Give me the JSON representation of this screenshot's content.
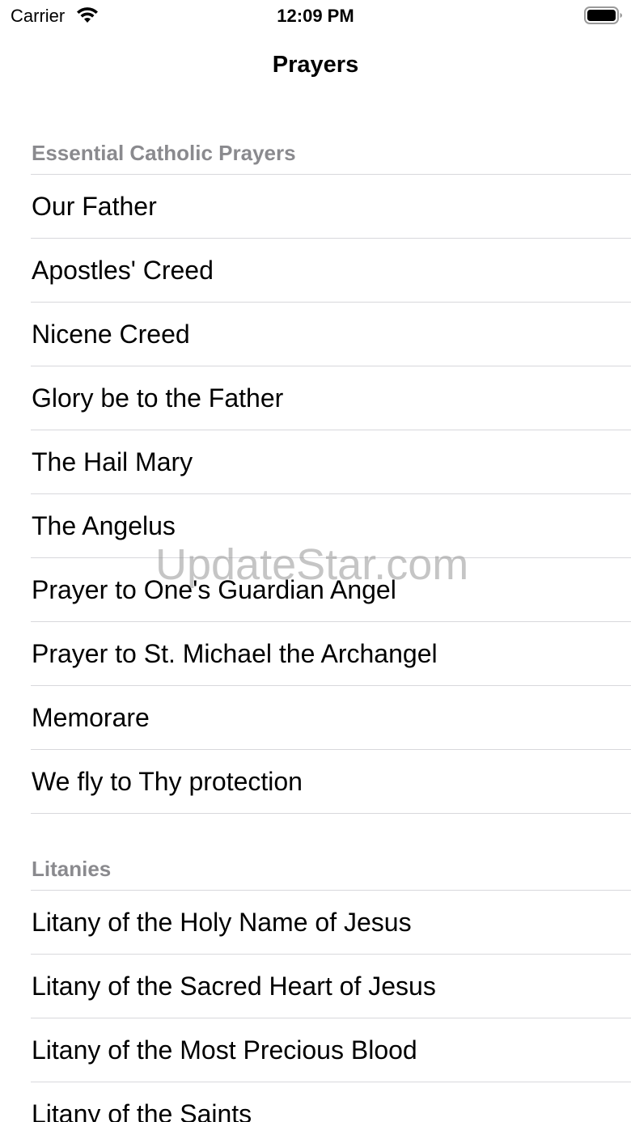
{
  "status_bar": {
    "carrier": "Carrier",
    "time": "12:09 PM",
    "wifi_icon": "wifi-icon",
    "battery_icon": "battery-icon"
  },
  "nav": {
    "title": "Prayers"
  },
  "sections": [
    {
      "header": "Essential Catholic Prayers",
      "items": [
        "Our Father",
        "Apostles' Creed",
        "Nicene Creed",
        "Glory be to the Father",
        "The Hail Mary",
        "The Angelus",
        "Prayer to One's Guardian Angel",
        "Prayer to St. Michael the Archangel",
        "Memorare",
        "We fly to Thy protection"
      ]
    },
    {
      "header": "Litanies",
      "items": [
        "Litany of the Holy Name of Jesus",
        "Litany of the Sacred Heart of Jesus",
        "Litany of the Most Precious Blood",
        "Litany of the Saints"
      ]
    }
  ],
  "watermark": "UpdateStar.com",
  "colors": {
    "section_header": "#8a8a8e",
    "separator": "#d8d8dc",
    "text": "#000000",
    "background": "#ffffff"
  }
}
